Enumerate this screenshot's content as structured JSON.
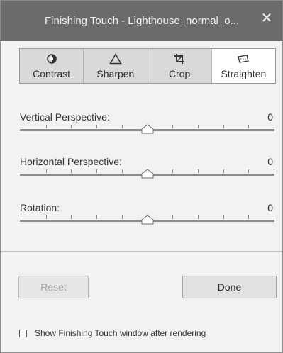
{
  "window": {
    "title": "Finishing Touch - Lighthouse_normal_o...",
    "close_glyph": "✕"
  },
  "tabs": [
    {
      "label": "Contrast",
      "icon": "contrast-icon",
      "selected": false
    },
    {
      "label": "Sharpen",
      "icon": "sharpen-triangle-icon",
      "selected": false
    },
    {
      "label": "Crop",
      "icon": "crop-icon",
      "selected": false
    },
    {
      "label": "Straighten",
      "icon": "straighten-icon",
      "selected": true
    }
  ],
  "sliders": [
    {
      "label": "Vertical Perspective:",
      "value": "0",
      "level": 0.5
    },
    {
      "label": "Horizontal Perspective:",
      "value": "0",
      "level": 0.5
    },
    {
      "label": "Rotation:",
      "value": "0",
      "level": 0.5
    }
  ],
  "buttons": {
    "reset_label": "Reset",
    "done_label": "Done"
  },
  "footer": {
    "checkbox_label": "Show Finishing Touch window after rendering",
    "checked": false
  },
  "colors": {
    "titlebar": "#6b6b6b",
    "panel": "#f2f2f2",
    "tab_inactive": "#d9d9d9",
    "tab_active": "#ffffff"
  }
}
